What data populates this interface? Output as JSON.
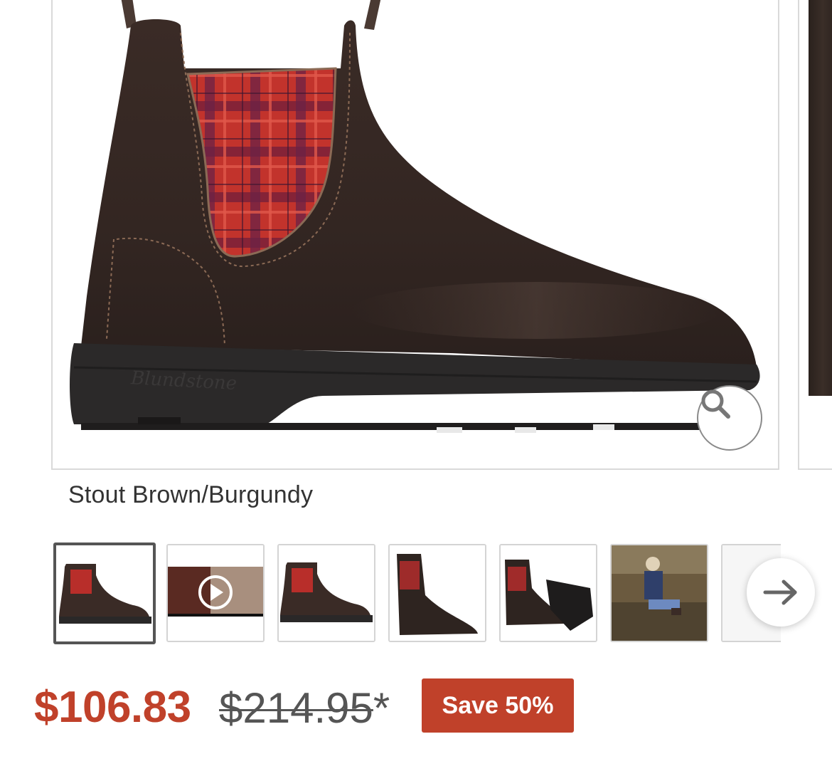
{
  "product": {
    "variant_name": "Stout Brown/Burgundy",
    "main_image": "boot-side-view",
    "zoom_icon": "magnifier-icon"
  },
  "thumbnails": [
    {
      "label": "boot side view",
      "active": true
    },
    {
      "label": "product video",
      "video": true
    },
    {
      "label": "boot side view alt"
    },
    {
      "label": "boot angled view"
    },
    {
      "label": "boot pair sole view"
    },
    {
      "label": "lifestyle photo"
    },
    {
      "label": "more"
    }
  ],
  "next_icon": "arrow-right-icon",
  "pricing": {
    "sale_price": "$106.83",
    "original_price": "$214.95",
    "original_suffix": "*",
    "save_label": "Save 50%"
  },
  "colors": {
    "accent": "#c0412a",
    "leather": "#3b2c27",
    "sole": "#2a2828",
    "plaid_red": "#c2332c",
    "plaid_purple": "#5a2346"
  }
}
